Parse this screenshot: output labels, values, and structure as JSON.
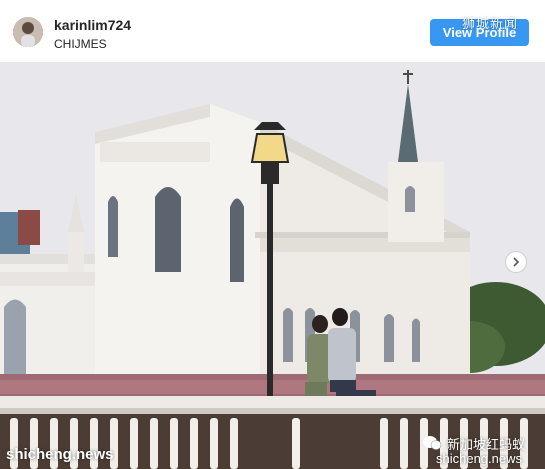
{
  "header": {
    "username": "karinlim724",
    "location": "CHIJMES",
    "view_profile_label": "View Profile"
  },
  "watermarks": {
    "top_right": "狮城新闻",
    "bottom_left": "shicheng.news",
    "bottom_right_name": "新加坡红蚂蚁",
    "bottom_right_site": "shicheng.news"
  },
  "icons": {
    "avatar": "profile-photo",
    "next": "chevron-right-icon",
    "logo": "chat-bubble-logo"
  },
  "colors": {
    "button": "#3897f0",
    "sky": "#e9e9ee",
    "building": "#f4f2ef"
  }
}
